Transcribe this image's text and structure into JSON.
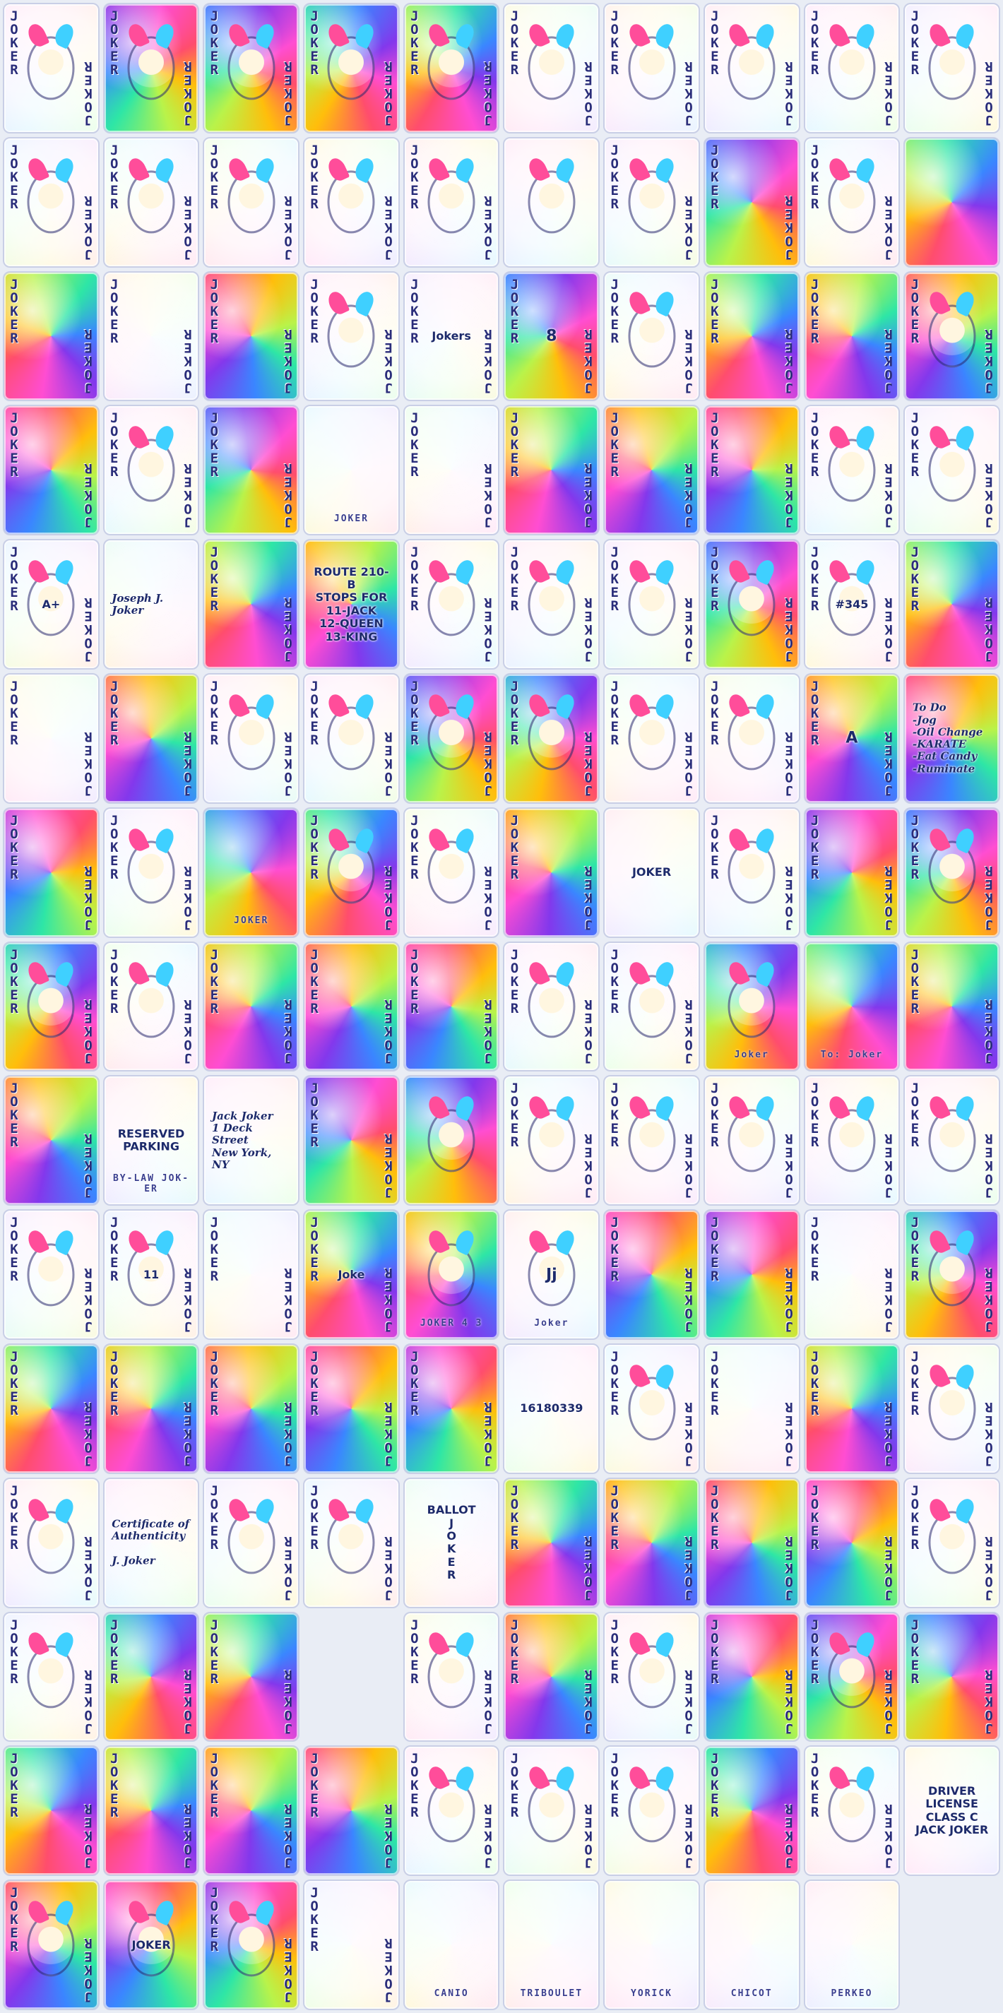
{
  "card_label": "JOKER",
  "cards": [
    {
      "pip": true,
      "fig": true,
      "tone": "pale",
      "rot": 20
    },
    {
      "pip": true,
      "fig": true,
      "tone": "vivid",
      "rot": 60
    },
    {
      "pip": true,
      "fig": true,
      "tone": "vivid",
      "rot": 110
    },
    {
      "pip": true,
      "fig": true,
      "tone": "vivid",
      "rot": 160
    },
    {
      "pip": true,
      "fig": true,
      "tone": "vivid",
      "rot": 210
    },
    {
      "pip": true,
      "fig": true,
      "tone": "pale",
      "rot": 250
    },
    {
      "pip": true,
      "fig": true,
      "tone": "pale",
      "rot": 300
    },
    {
      "pip": true,
      "fig": true,
      "tone": "pale",
      "rot": 340
    },
    {
      "pip": true,
      "fig": true,
      "tone": "pale",
      "rot": 30
    },
    {
      "pip": true,
      "fig": true,
      "tone": "pale",
      "rot": 80
    },
    {
      "pip": true,
      "fig": true,
      "tone": "pale",
      "rot": 120
    },
    {
      "pip": true,
      "fig": true,
      "tone": "pale",
      "rot": 170
    },
    {
      "pip": true,
      "fig": true,
      "tone": "pale",
      "rot": 220
    },
    {
      "pip": true,
      "fig": true,
      "tone": "pale",
      "rot": 270
    },
    {
      "pip": true,
      "fig": true,
      "tone": "pale",
      "rot": 320
    },
    {
      "pip": false,
      "fig": true,
      "tone": "pale",
      "rot": 10
    },
    {
      "pip": true,
      "fig": true,
      "tone": "pale",
      "rot": 50
    },
    {
      "pip": true,
      "fig": false,
      "tone": "vivid",
      "rot": 100
    },
    {
      "pip": true,
      "fig": true,
      "tone": "pale",
      "rot": 150
    },
    {
      "pip": false,
      "fig": false,
      "tone": "vivid",
      "rot": 200
    },
    {
      "pip": true,
      "fig": false,
      "tone": "vivid",
      "rot": 240
    },
    {
      "pip": true,
      "fig": false,
      "tone": "pale",
      "rot": 290
    },
    {
      "pip": true,
      "fig": false,
      "tone": "vivid",
      "rot": 330
    },
    {
      "pip": true,
      "fig": true,
      "tone": "pale",
      "rot": 15
    },
    {
      "pip": true,
      "fig": false,
      "tone": "pale",
      "rot": 65,
      "text": "Jokers"
    },
    {
      "pip": true,
      "fig": false,
      "tone": "vivid",
      "rot": 115,
      "text": "8",
      "big": true
    },
    {
      "pip": true,
      "fig": true,
      "tone": "pale",
      "rot": 165
    },
    {
      "pip": true,
      "fig": false,
      "tone": "vivid",
      "rot": 215
    },
    {
      "pip": true,
      "fig": false,
      "tone": "vivid",
      "rot": 265
    },
    {
      "pip": true,
      "fig": true,
      "tone": "vivid",
      "rot": 315
    },
    {
      "pip": true,
      "fig": false,
      "tone": "vivid",
      "rot": 355
    },
    {
      "pip": true,
      "fig": true,
      "tone": "pale",
      "rot": 45
    },
    {
      "pip": true,
      "fig": false,
      "tone": "vivid",
      "rot": 95
    },
    {
      "pip": false,
      "fig": false,
      "tone": "pale",
      "rot": 145,
      "name": "JOKER"
    },
    {
      "pip": true,
      "fig": false,
      "tone": "pale",
      "rot": 195
    },
    {
      "pip": true,
      "fig": false,
      "tone": "vivid",
      "rot": 245
    },
    {
      "pip": true,
      "fig": false,
      "tone": "vivid",
      "rot": 295
    },
    {
      "pip": true,
      "fig": false,
      "tone": "vivid",
      "rot": 345
    },
    {
      "pip": true,
      "fig": true,
      "tone": "pale",
      "rot": 25
    },
    {
      "pip": true,
      "fig": true,
      "tone": "pale",
      "rot": 75
    },
    {
      "pip": true,
      "fig": true,
      "tone": "pale",
      "rot": 125,
      "text": "A+"
    },
    {
      "pip": false,
      "fig": false,
      "tone": "pale",
      "rot": 175,
      "text": "Joseph J. Joker",
      "hand": true
    },
    {
      "pip": true,
      "fig": false,
      "tone": "vivid",
      "rot": 225
    },
    {
      "pip": false,
      "fig": false,
      "tone": "vivid",
      "rot": 275,
      "text": "ROUTE 210-B\nSTOPS FOR\n11-JACK\n12-QUEEN\n13-KING"
    },
    {
      "pip": true,
      "fig": true,
      "tone": "pale",
      "rot": 325
    },
    {
      "pip": true,
      "fig": true,
      "tone": "pale",
      "rot": 5
    },
    {
      "pip": true,
      "fig": true,
      "tone": "pale",
      "rot": 55
    },
    {
      "pip": true,
      "fig": true,
      "tone": "vivid",
      "rot": 105
    },
    {
      "pip": true,
      "fig": true,
      "tone": "pale",
      "rot": 155,
      "text": "#345"
    },
    {
      "pip": true,
      "fig": false,
      "tone": "vivid",
      "rot": 205
    },
    {
      "pip": true,
      "fig": false,
      "tone": "pale",
      "rot": 255
    },
    {
      "pip": true,
      "fig": false,
      "tone": "vivid",
      "rot": 305
    },
    {
      "pip": true,
      "fig": true,
      "tone": "pale",
      "rot": 350
    },
    {
      "pip": true,
      "fig": true,
      "tone": "pale",
      "rot": 40
    },
    {
      "pip": true,
      "fig": true,
      "tone": "vivid",
      "rot": 90
    },
    {
      "pip": true,
      "fig": true,
      "tone": "vivid",
      "rot": 140
    },
    {
      "pip": true,
      "fig": true,
      "tone": "pale",
      "rot": 190
    },
    {
      "pip": true,
      "fig": true,
      "tone": "pale",
      "rot": 240
    },
    {
      "pip": true,
      "fig": false,
      "tone": "vivid",
      "rot": 290,
      "text": "A",
      "big": true
    },
    {
      "pip": false,
      "fig": false,
      "tone": "vivid",
      "rot": 335,
      "text": "To Do\n-Jog\n-Oil Change\n-KARATE\n-Eat Candy\n-Ruminate",
      "hand": true
    },
    {
      "pip": true,
      "fig": false,
      "tone": "vivid",
      "rot": 35
    },
    {
      "pip": true,
      "fig": true,
      "tone": "pale",
      "rot": 85
    },
    {
      "pip": false,
      "fig": false,
      "tone": "vivid",
      "rot": 135,
      "name": "JOKER"
    },
    {
      "pip": true,
      "fig": true,
      "tone": "vivid",
      "rot": 185
    },
    {
      "pip": true,
      "fig": true,
      "tone": "pale",
      "rot": 235
    },
    {
      "pip": true,
      "fig": false,
      "tone": "vivid",
      "rot": 285
    },
    {
      "pip": false,
      "fig": false,
      "tone": "pale",
      "rot": 330,
      "text": "JOKER"
    },
    {
      "pip": true,
      "fig": true,
      "tone": "pale",
      "rot": 10
    },
    {
      "pip": true,
      "fig": false,
      "tone": "vivid",
      "rot": 60
    },
    {
      "pip": true,
      "fig": true,
      "tone": "vivid",
      "rot": 110
    },
    {
      "pip": true,
      "fig": true,
      "tone": "vivid",
      "rot": 160
    },
    {
      "pip": true,
      "fig": true,
      "tone": "pale",
      "rot": 210
    },
    {
      "pip": true,
      "fig": false,
      "tone": "vivid",
      "rot": 260
    },
    {
      "pip": true,
      "fig": false,
      "tone": "vivid",
      "rot": 310
    },
    {
      "pip": true,
      "fig": false,
      "tone": "vivid",
      "rot": 355
    },
    {
      "pip": true,
      "fig": true,
      "tone": "pale",
      "rot": 45
    },
    {
      "pip": true,
      "fig": true,
      "tone": "pale",
      "rot": 95
    },
    {
      "pip": false,
      "fig": true,
      "tone": "vivid",
      "rot": 145,
      "name": "Joker"
    },
    {
      "pip": false,
      "fig": false,
      "tone": "vivid",
      "rot": 195,
      "name": "To: Joker"
    },
    {
      "pip": true,
      "fig": false,
      "tone": "vivid",
      "rot": 245
    },
    {
      "pip": true,
      "fig": false,
      "tone": "vivid",
      "rot": 295
    },
    {
      "pip": false,
      "fig": false,
      "tone": "pale",
      "rot": 340,
      "text": "RESERVED\nPARKING",
      "name": "BY-LAW JOK-ER"
    },
    {
      "pip": false,
      "fig": false,
      "tone": "pale",
      "rot": 25,
      "text": "Jack Joker\n1 Deck Street\nNew York, NY",
      "hand": true
    },
    {
      "pip": true,
      "fig": false,
      "tone": "vivid",
      "rot": 75
    },
    {
      "pip": false,
      "fig": true,
      "tone": "vivid",
      "rot": 125
    },
    {
      "pip": true,
      "fig": true,
      "tone": "pale",
      "rot": 175
    },
    {
      "pip": true,
      "fig": true,
      "tone": "pale",
      "rot": 225
    },
    {
      "pip": true,
      "fig": true,
      "tone": "pale",
      "rot": 275
    },
    {
      "pip": true,
      "fig": true,
      "tone": "pale",
      "rot": 325
    },
    {
      "pip": true,
      "fig": true,
      "tone": "pale",
      "rot": 15
    },
    {
      "pip": true,
      "fig": true,
      "tone": "pale",
      "rot": 65
    },
    {
      "pip": true,
      "fig": true,
      "tone": "pale",
      "rot": 115,
      "text": "11"
    },
    {
      "pip": true,
      "fig": false,
      "tone": "pale",
      "rot": 165
    },
    {
      "pip": true,
      "fig": false,
      "tone": "vivid",
      "rot": 215,
      "text": "Joke"
    },
    {
      "pip": false,
      "fig": true,
      "tone": "vivid",
      "rot": 265,
      "name": "JOKER 4 3"
    },
    {
      "pip": false,
      "fig": true,
      "tone": "pale",
      "rot": 315,
      "text": "Jj",
      "name": "Joker",
      "big": true
    },
    {
      "pip": true,
      "fig": false,
      "tone": "vivid",
      "rot": 5
    },
    {
      "pip": true,
      "fig": false,
      "tone": "vivid",
      "rot": 55
    },
    {
      "pip": true,
      "fig": false,
      "tone": "pale",
      "rot": 105
    },
    {
      "pip": true,
      "fig": true,
      "tone": "vivid",
      "rot": 155
    },
    {
      "pip": true,
      "fig": false,
      "tone": "vivid",
      "rot": 205
    },
    {
      "pip": true,
      "fig": false,
      "tone": "vivid",
      "rot": 255
    },
    {
      "pip": true,
      "fig": false,
      "tone": "vivid",
      "rot": 305
    },
    {
      "pip": true,
      "fig": false,
      "tone": "vivid",
      "rot": 350
    },
    {
      "pip": true,
      "fig": false,
      "tone": "vivid",
      "rot": 40
    },
    {
      "pip": false,
      "fig": false,
      "tone": "pale",
      "rot": 90,
      "text": "16180339"
    },
    {
      "pip": true,
      "fig": true,
      "tone": "pale",
      "rot": 140
    },
    {
      "pip": true,
      "fig": false,
      "tone": "pale",
      "rot": 190
    },
    {
      "pip": true,
      "fig": false,
      "tone": "vivid",
      "rot": 240
    },
    {
      "pip": true,
      "fig": true,
      "tone": "pale",
      "rot": 290
    },
    {
      "pip": true,
      "fig": true,
      "tone": "pale",
      "rot": 335
    },
    {
      "pip": false,
      "fig": false,
      "tone": "pale",
      "rot": 30,
      "text": "Certificate of\nAuthenticity\n\nJ. Joker",
      "hand": true
    },
    {
      "pip": true,
      "fig": true,
      "tone": "pale",
      "rot": 80
    },
    {
      "pip": true,
      "fig": true,
      "tone": "pale",
      "rot": 130
    },
    {
      "pip": false,
      "fig": false,
      "tone": "pale",
      "rot": 180,
      "text": "BALLOT\nJ\nO\nK\nE\nR"
    },
    {
      "pip": true,
      "fig": false,
      "tone": "vivid",
      "rot": 230
    },
    {
      "pip": true,
      "fig": false,
      "tone": "vivid",
      "rot": 280
    },
    {
      "pip": true,
      "fig": false,
      "tone": "vivid",
      "rot": 325
    },
    {
      "pip": true,
      "fig": false,
      "tone": "vivid",
      "rot": 10
    },
    {
      "pip": true,
      "fig": true,
      "tone": "pale",
      "rot": 60
    },
    {
      "pip": true,
      "fig": true,
      "tone": "pale",
      "rot": 110
    },
    {
      "pip": true,
      "fig": false,
      "tone": "vivid",
      "rot": 160
    },
    {
      "pip": true,
      "fig": false,
      "tone": "vivid",
      "rot": 210
    },
    {
      "pip": false,
      "fig": false,
      "tone": "blank",
      "rot": 0
    },
    {
      "pip": true,
      "fig": true,
      "tone": "pale",
      "rot": 250
    },
    {
      "pip": true,
      "fig": false,
      "tone": "vivid",
      "rot": 300
    },
    {
      "pip": true,
      "fig": true,
      "tone": "pale",
      "rot": 345
    },
    {
      "pip": true,
      "fig": false,
      "tone": "vivid",
      "rot": 35
    },
    {
      "pip": true,
      "fig": true,
      "tone": "vivid",
      "rot": 85
    },
    {
      "pip": true,
      "fig": false,
      "tone": "vivid",
      "rot": 135
    },
    {
      "pip": true,
      "fig": false,
      "tone": "vivid",
      "rot": 185
    },
    {
      "pip": true,
      "fig": false,
      "tone": "vivid",
      "rot": 235
    },
    {
      "pip": true,
      "fig": false,
      "tone": "vivid",
      "rot": 285
    },
    {
      "pip": true,
      "fig": false,
      "tone": "vivid",
      "rot": 330
    },
    {
      "pip": true,
      "fig": true,
      "tone": "pale",
      "rot": 20
    },
    {
      "pip": true,
      "fig": true,
      "tone": "pale",
      "rot": 70
    },
    {
      "pip": true,
      "fig": true,
      "tone": "pale",
      "rot": 120
    },
    {
      "pip": true,
      "fig": false,
      "tone": "vivid",
      "rot": 170
    },
    {
      "pip": true,
      "fig": true,
      "tone": "pale",
      "rot": 220
    },
    {
      "pip": false,
      "fig": false,
      "tone": "pale",
      "rot": 270,
      "text": "DRIVER LICENSE\nCLASS C\nJACK JOKER"
    },
    {
      "pip": true,
      "fig": true,
      "tone": "vivid",
      "rot": 320
    },
    {
      "pip": false,
      "fig": true,
      "tone": "vivid",
      "rot": 5,
      "text": "JOKER"
    },
    {
      "pip": true,
      "fig": true,
      "tone": "vivid",
      "rot": 55
    },
    {
      "pip": true,
      "fig": false,
      "tone": "pale",
      "rot": 105
    },
    {
      "pip": false,
      "fig": false,
      "tone": "pale",
      "rot": 155,
      "name": "CANIO"
    },
    {
      "pip": false,
      "fig": false,
      "tone": "pale",
      "rot": 205,
      "name": "TRIBOULET"
    },
    {
      "pip": false,
      "fig": false,
      "tone": "pale",
      "rot": 255,
      "name": "YORICK"
    },
    {
      "pip": false,
      "fig": false,
      "tone": "pale",
      "rot": 305,
      "name": "CHICOT"
    },
    {
      "pip": false,
      "fig": false,
      "tone": "pale",
      "rot": 350,
      "name": "PERKEO"
    }
  ]
}
